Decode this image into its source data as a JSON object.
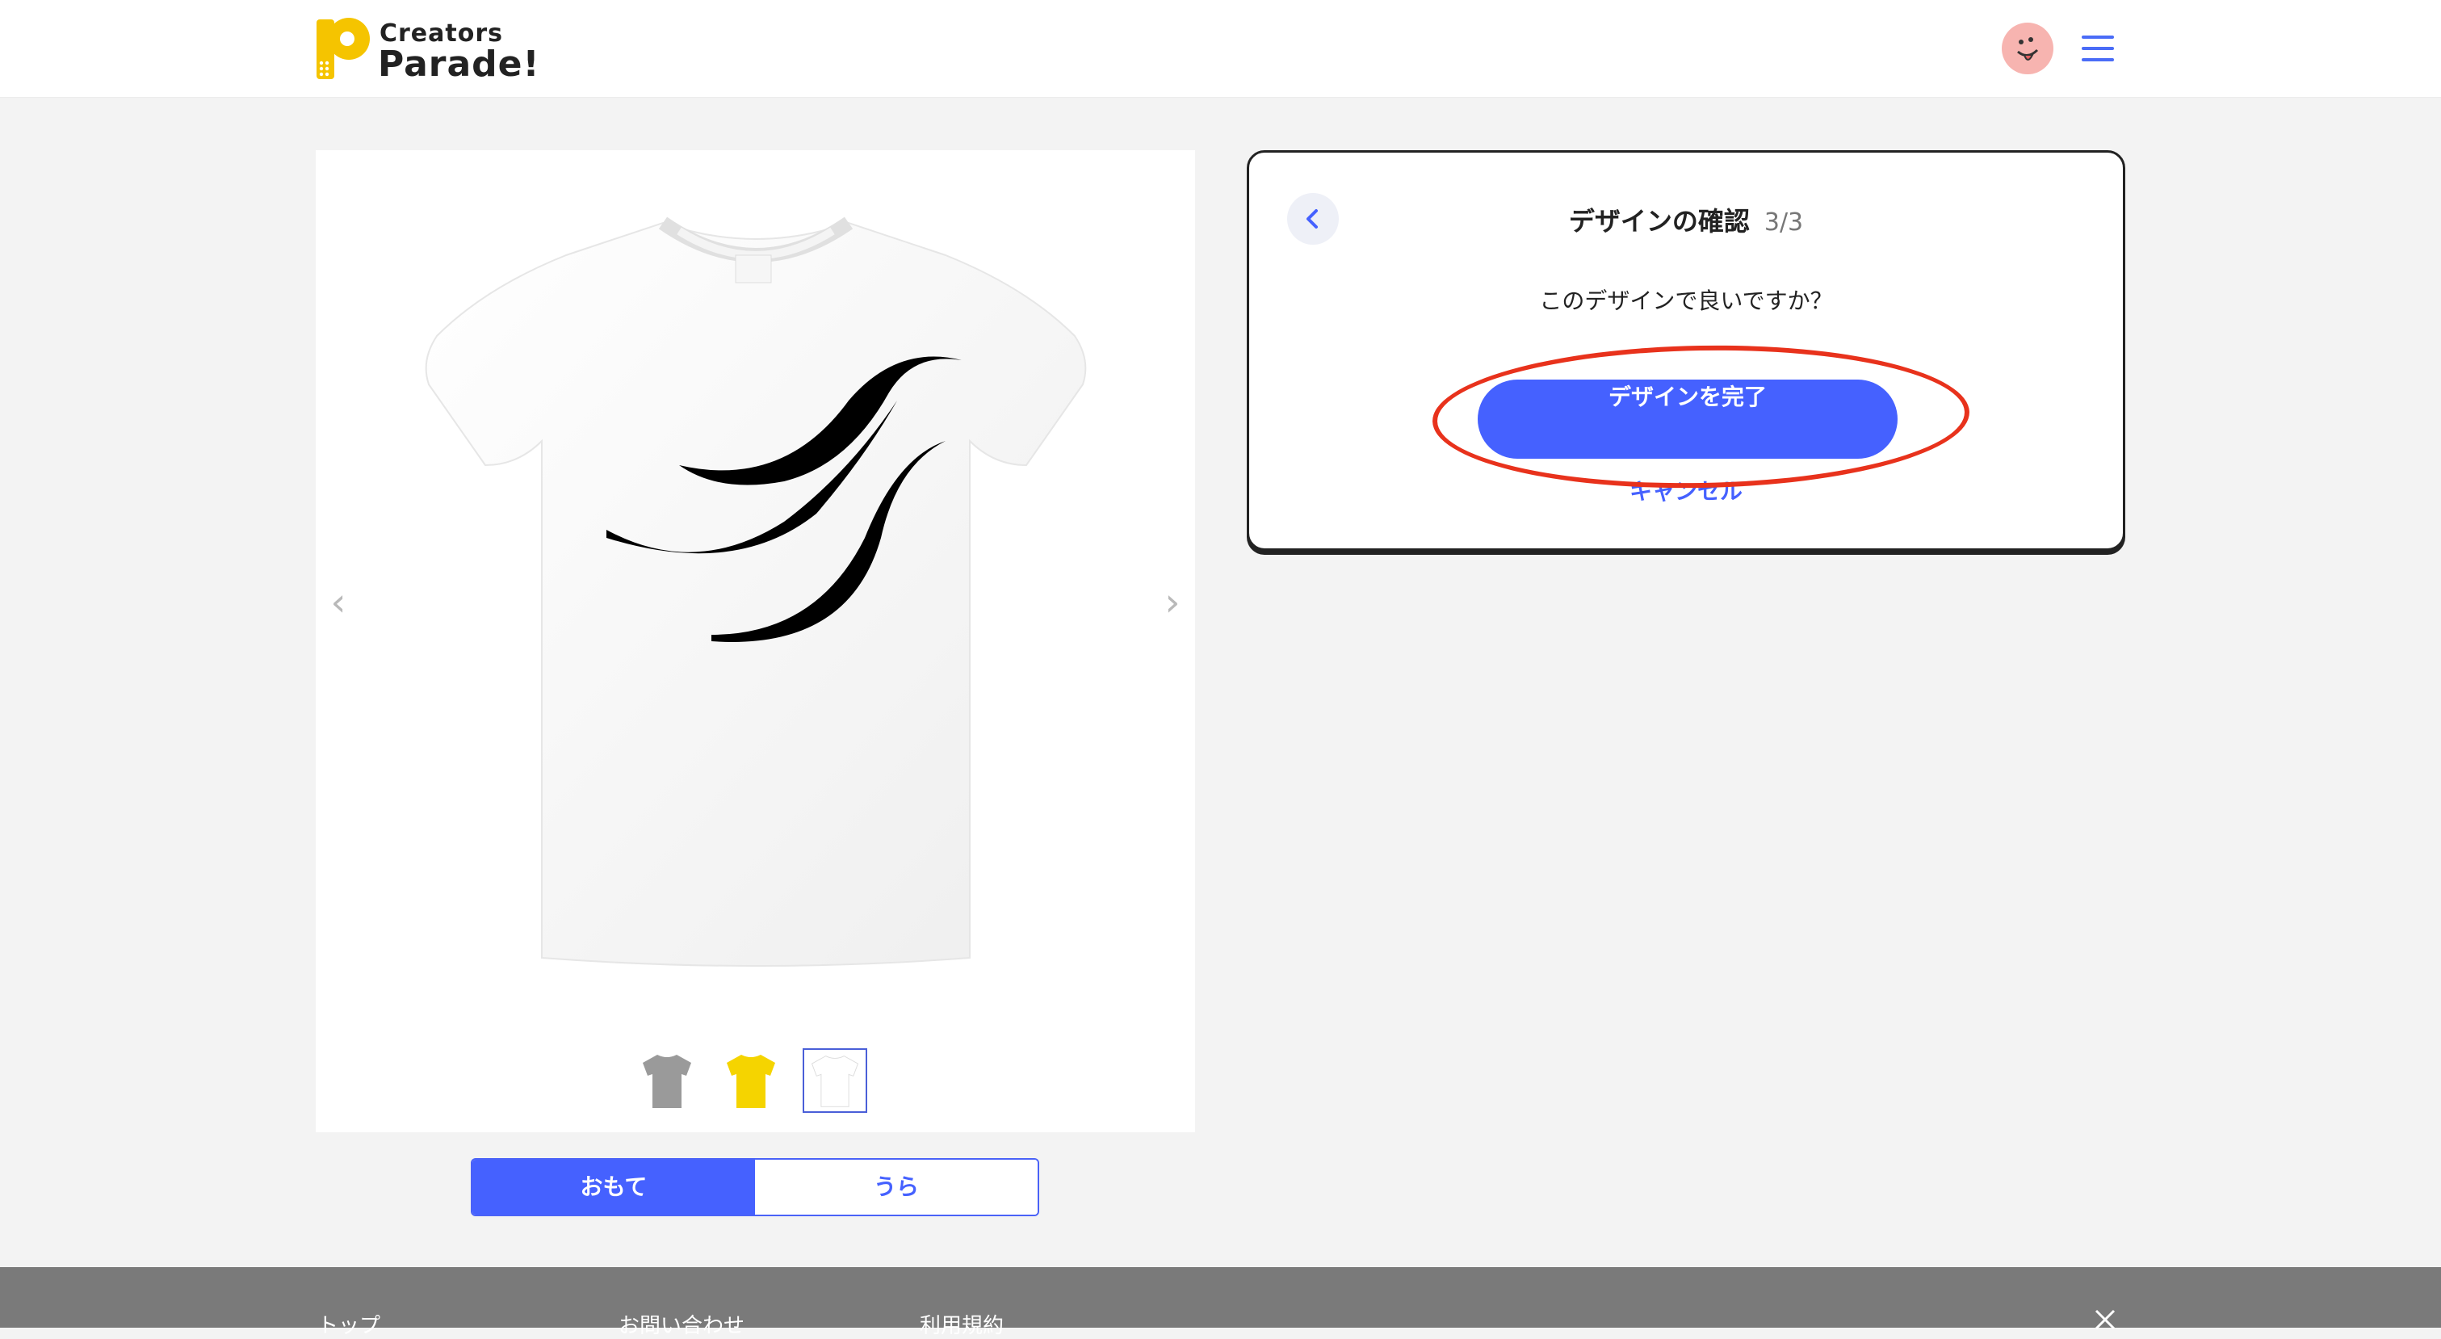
{
  "header": {
    "logo_top": "Creators",
    "logo_bottom": "Parade!"
  },
  "preview": {
    "prev_arrow": "‹",
    "next_arrow": "›",
    "thumbnails": [
      {
        "color": "#9a9a9a",
        "name": "gray"
      },
      {
        "color": "#f5d400",
        "name": "yellow"
      },
      {
        "color": "#ffffff",
        "name": "white"
      }
    ],
    "selected_thumbnail": "white",
    "shirt_color": "#ffffff"
  },
  "side_toggle": {
    "front": "おもて",
    "back": "うら",
    "selected": "front"
  },
  "confirm_panel": {
    "title": "デザインの確認",
    "step": "3/3",
    "question": "このデザインで良いですか？",
    "complete_button": "デザインを完了",
    "cancel_link": "キャンセル"
  },
  "footer": {
    "links": [
      "トップ",
      "お問い合わせ",
      "利用規約"
    ]
  },
  "colors": {
    "accent": "#4561ff",
    "highlight": "#e8321c",
    "footer_bg": "#7a7a7a"
  }
}
